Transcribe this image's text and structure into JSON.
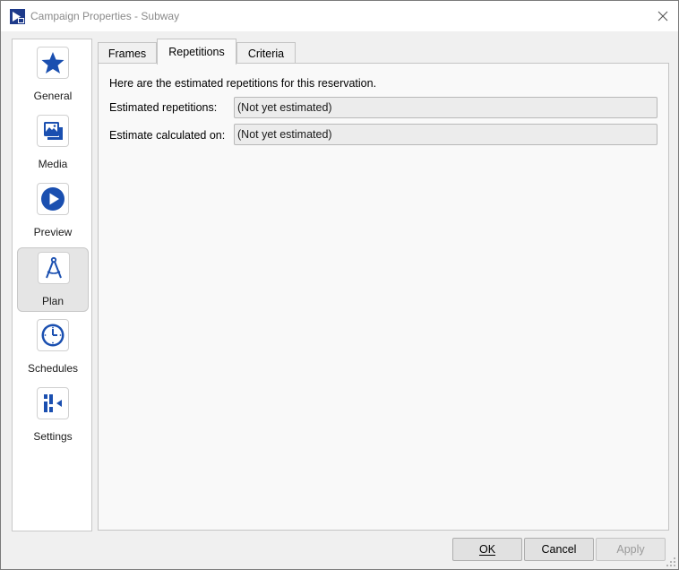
{
  "window": {
    "title": "Campaign Properties - Subway",
    "close_glyph": "✕"
  },
  "sidebar": {
    "items": [
      {
        "label": "General",
        "icon": "star-icon"
      },
      {
        "label": "Media",
        "icon": "media-image-icon"
      },
      {
        "label": "Preview",
        "icon": "play-icon"
      },
      {
        "label": "Plan",
        "icon": "compass-icon",
        "active": true
      },
      {
        "label": "Schedules",
        "icon": "clock-icon"
      },
      {
        "label": "Settings",
        "icon": "settings-sliders-icon"
      }
    ]
  },
  "tabs": [
    {
      "label": "Frames"
    },
    {
      "label": "Repetitions",
      "active": true
    },
    {
      "label": "Criteria"
    }
  ],
  "repetitions": {
    "intro": "Here are the estimated repetitions for this reservation.",
    "estimated_label": "Estimated repetitions:",
    "estimated_value": "(Not yet estimated)",
    "calculated_label": "Estimate calculated on:",
    "calculated_value": "(Not yet estimated)"
  },
  "buttons": {
    "ok": "OK",
    "cancel": "Cancel",
    "apply": "Apply"
  },
  "colors": {
    "accent_blue": "#1a4fb0"
  }
}
